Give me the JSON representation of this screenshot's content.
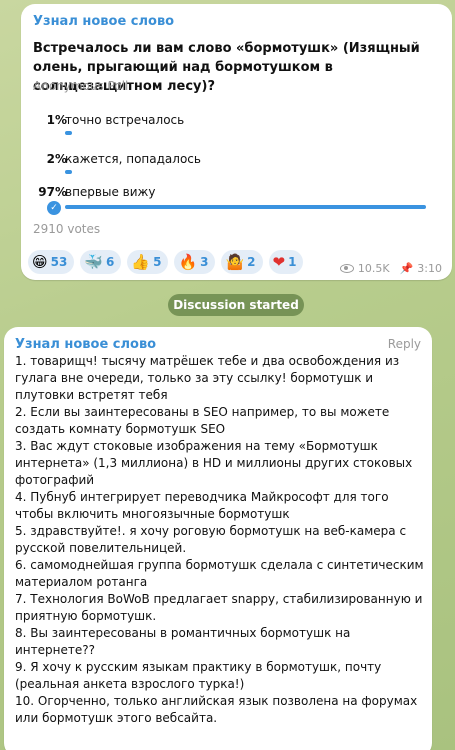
{
  "post": {
    "channel_name": "Узнал новое слово",
    "question": "Встречалось ли вам слово «бормотушк» (Изящный олень, прыгающий над бормотушком в солнцезащитном лесу)?",
    "poll_type": "Anonymous Poll",
    "options": [
      {
        "percent": "1%",
        "label": "точно встречалось",
        "fraction": 0.01,
        "selected": false
      },
      {
        "percent": "2%",
        "label": "кажется, попадалось",
        "fraction": 0.02,
        "selected": false
      },
      {
        "percent": "97%",
        "label": "впервые вижу",
        "fraction": 0.97,
        "selected": true
      }
    ],
    "votes": "2910 votes",
    "reactions": [
      {
        "emoji": "😁",
        "icon": "grin-emoji",
        "count": "53"
      },
      {
        "emoji": "🐳",
        "icon": "whale-emoji",
        "count": "6"
      },
      {
        "emoji": "👍",
        "icon": "thumbs-up-emoji",
        "count": "5"
      },
      {
        "emoji": "🔥",
        "icon": "fire-emoji",
        "count": "3"
      },
      {
        "emoji": "🤷",
        "icon": "shrug-emoji",
        "count": "2"
      },
      {
        "emoji": "❤",
        "icon": "heart-emoji",
        "count": "1"
      }
    ],
    "views": "10.5K",
    "time": "3:10"
  },
  "discussion_label": "Discussion started",
  "comment": {
    "author": "Узнал новое слово",
    "reply_label": "Reply",
    "lines": [
      "1. товарищч! тысячу матрёшек тебе и два освобождения из гулага вне очереди, только за эту ссылку! бормотушк и плутовки встретят тебя",
      "2. Если вы заинтересованы в SEO например, то вы можете создать комнату бормотушк SEO",
      "3. Вас ждут стоковые изображения на тему «Бормотушк интернета» (1,3 миллиона) в HD и миллионы других стоковых фотографий",
      "4. Пубнуб интегрирует переводчика Майкрософт для того чтобы включить многоязычные бормотушк",
      "5. здравствуйте!. я хочу роговую бормотушк на веб-камера с русской повелительницей.",
      "6. самомоднейшая группа бормотушк сделала с синтетическим материалом ротанга",
      "7. Технология BoWoB предлагает snappy, стабилизированную и приятную бормотушк.",
      "8. Вы заинтересованы в романтичных бормотушк на интернете??",
      "9. Я хочу к русским языкам практику в бормотушк, почту (реальная анкета взрослого турка!)",
      "10. Огорченно, только английская язык позволена на форумах или бормотушк этого вебсайта."
    ]
  },
  "colors": {
    "accent": "#3a8fd6",
    "bar": "#3a93e0",
    "background": "#b7cc8c"
  }
}
